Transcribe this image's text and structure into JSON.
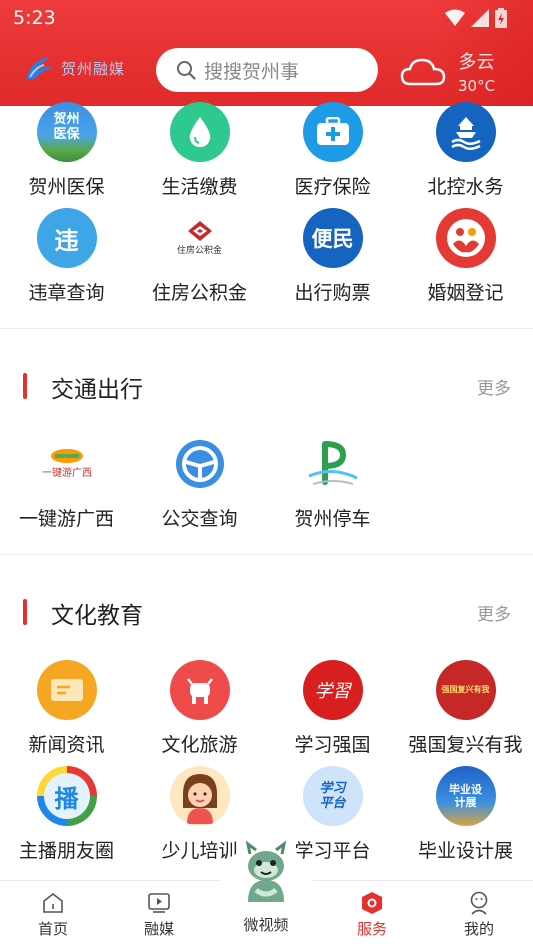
{
  "status": {
    "time": "5:23"
  },
  "header": {
    "logo_text": "贺州融媒",
    "search_placeholder": "搜搜贺州事",
    "weather": {
      "desc": "多云",
      "temp": "30°C"
    }
  },
  "top_grid": [
    [
      {
        "label": "贺州医保",
        "icon": "hezhou-medical-insurance-icon",
        "badge": "贺州\n医保"
      },
      {
        "label": "生活缴费",
        "icon": "water-drop-icon"
      },
      {
        "label": "医疗保险",
        "icon": "medical-kit-icon"
      },
      {
        "label": "北控水务",
        "icon": "waterworks-tower-icon"
      }
    ],
    [
      {
        "label": "违章查询",
        "icon": "traffic-violation-icon",
        "glyph": "违"
      },
      {
        "label": "住房公积金",
        "icon": "housing-fund-logo",
        "caption": "住房公积金"
      },
      {
        "label": "出行购票",
        "icon": "ticket-icon",
        "glyph": "便民"
      },
      {
        "label": "婚姻登记",
        "icon": "marriage-registration-icon"
      }
    ]
  ],
  "sections": [
    {
      "title": "交通出行",
      "more": "更多",
      "items": [
        {
          "label": "一键游广西",
          "icon": "guangxi-travel-logo"
        },
        {
          "label": "公交查询",
          "icon": "bus-steering-icon"
        },
        {
          "label": "贺州停车",
          "icon": "parking-icon"
        }
      ]
    },
    {
      "title": "文化教育",
      "more": "更多",
      "items": [
        {
          "label": "新闻资讯",
          "icon": "news-card-icon"
        },
        {
          "label": "文化旅游",
          "icon": "ox-icon"
        },
        {
          "label": "学习强国",
          "icon": "xuexi-qiangguo-icon",
          "glyph": "学習"
        },
        {
          "label": "强国复兴有我",
          "icon": "qiangguo-fuxing-icon",
          "glyph": "强国复兴有我"
        },
        {
          "label": "主播朋友圈",
          "icon": "anchor-circle-icon",
          "glyph": "播"
        },
        {
          "label": "少儿培训",
          "icon": "child-girl-icon"
        },
        {
          "label": "学习平台",
          "icon": "study-platform-icon",
          "glyph": "学习平台"
        },
        {
          "label": "毕业设计展",
          "icon": "graduation-design-icon",
          "glyph": "毕业设计展"
        }
      ]
    }
  ],
  "tabbar": {
    "items": [
      {
        "label": "首页",
        "icon": "home-icon"
      },
      {
        "label": "融媒",
        "icon": "media-icon"
      },
      {
        "label": "微视频",
        "icon": "mascot-icon"
      },
      {
        "label": "服务",
        "icon": "service-icon",
        "active": true
      },
      {
        "label": "我的",
        "icon": "profile-icon"
      }
    ]
  },
  "colors": {
    "brand_red": "#e53030",
    "text": "#222222",
    "muted": "#999999"
  }
}
